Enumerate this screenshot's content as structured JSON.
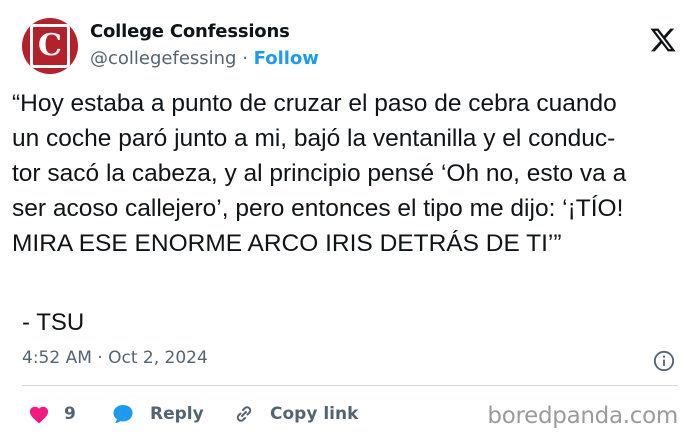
{
  "account": {
    "name": "College Confessions",
    "handle": "@collegefessing",
    "separator": " · ",
    "follow_label": "Follow",
    "avatar_letter": "C",
    "avatar_color": "#b5212b"
  },
  "platform_icon": "x-logo-icon",
  "tweet": {
    "lines": [
      "“Hoy estaba a punto de cruzar el paso de cebra cuando",
      "un coche paró junto a mi, bajó la ventanilla y el conduc-",
      "tor sacó la cabeza, y al principio pensé ‘Oh no, esto va a",
      "ser acoso callejero’, pero entonces el tipo me dijo: ‘¡TÍO!",
      "MIRA ESE ENORME ARCO IRIS DETRÁS DE TI’”"
    ],
    "signature": "- TSU"
  },
  "meta": {
    "timestamp": "4:52 AM · Oct 2, 2024",
    "info_icon": "info-icon"
  },
  "actions": {
    "like_count": "9",
    "reply_label": "Reply",
    "copy_link_label": "Copy link"
  },
  "watermark": "boredpanda.com",
  "colors": {
    "like": "#f91880",
    "reply": "#1d9bf0",
    "follow": "#1d9bf0",
    "muted": "#536471"
  }
}
